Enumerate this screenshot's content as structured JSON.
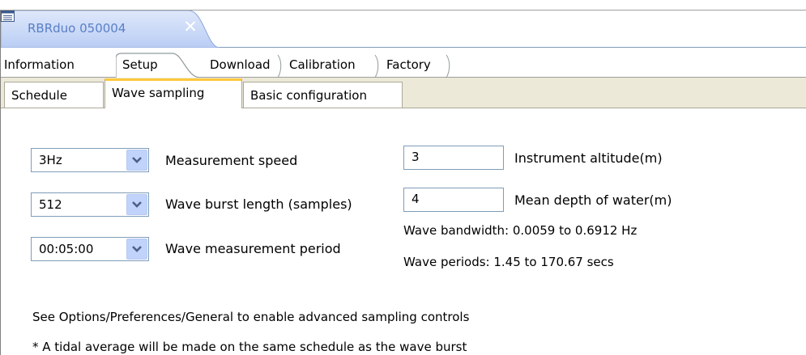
{
  "editor": {
    "title": "RBRduo 050004",
    "close_glyph": "✕",
    "tab_accent": "#5a7fc7"
  },
  "main_tabs": [
    "Information",
    "Setup",
    "Download",
    "Calibration",
    "Factory"
  ],
  "main_tabs_active": "Setup",
  "sub_tabs": [
    "Schedule",
    "Wave sampling",
    "Basic configuration"
  ],
  "sub_tabs_active": "Wave sampling",
  "wave_sampling": {
    "measurement_speed": {
      "value": "3Hz",
      "label": "Measurement speed"
    },
    "wave_burst_length": {
      "value": "512",
      "label": "Wave burst length (samples)"
    },
    "wave_measurement_period": {
      "value": "00:05:00",
      "label": "Wave measurement period"
    },
    "instrument_altitude": {
      "value": "3",
      "label": "Instrument altitude(m)"
    },
    "mean_depth": {
      "value": "4",
      "label": "Mean depth of water(m)"
    },
    "wave_bandwidth": "Wave bandwidth: 0.0059 to 0.6912 Hz",
    "wave_periods": "Wave periods: 1.45 to 170.67 secs",
    "note_advanced": "See Options/Preferences/General to enable advanced sampling controls",
    "note_tidal": "* A tidal average will be made on the same schedule as the wave burst"
  },
  "icons": {
    "document": "document-icon",
    "close": "close-icon",
    "dropdown": "chevron-down-icon"
  },
  "colors": {
    "active_tab_highlight": "#ffc83c",
    "combo_button": "#c1d3fb",
    "tab_background": "#ece9d8"
  }
}
